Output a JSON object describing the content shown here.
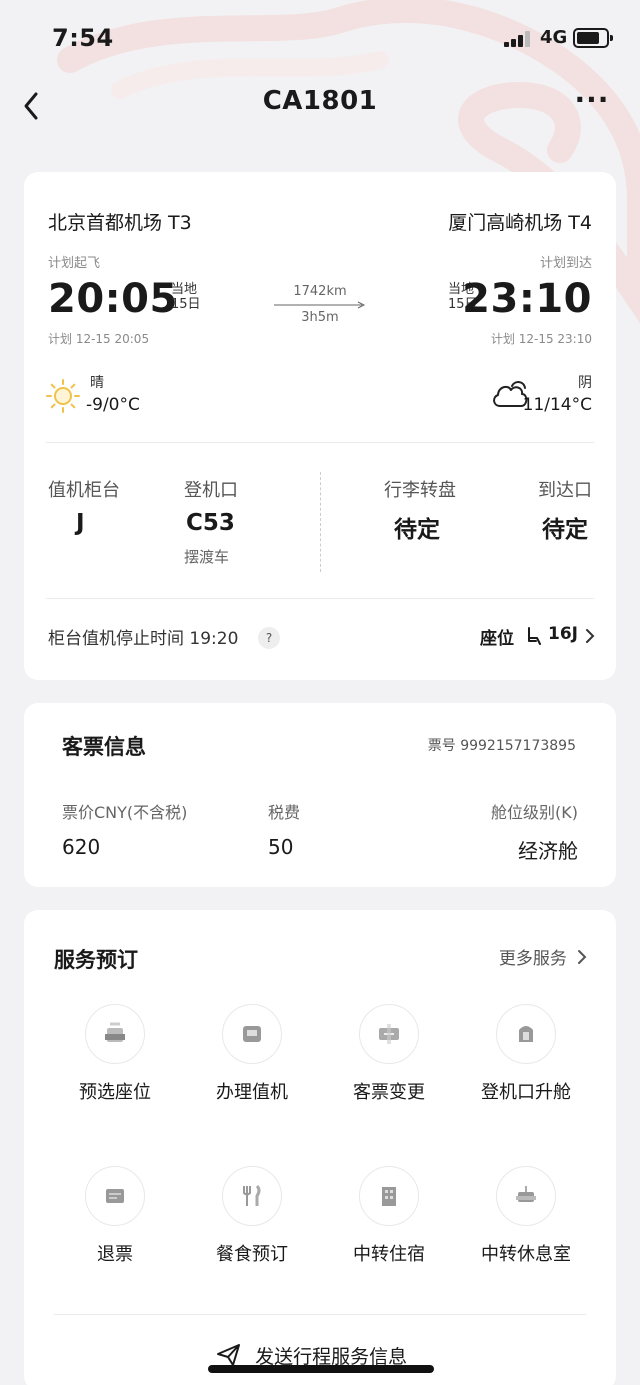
{
  "status_bar": {
    "time": "7:54",
    "network": "4G"
  },
  "nav": {
    "title": "CA1801",
    "more": "···"
  },
  "flight": {
    "departure": {
      "airport": "北京首都机场 T3",
      "label": "计划起飞",
      "time": "20:05",
      "local_label": "当地",
      "day": "15日",
      "plan": "计划 12-15 20:05",
      "weather": "晴",
      "temp": "-9/0°C"
    },
    "arrival": {
      "airport": "厦门高崎机场 T4",
      "label": "计划到达",
      "time": "23:10",
      "local_label": "当地",
      "day": "15日",
      "plan": "计划 12-15 23:10",
      "weather": "阴",
      "temp": "11/14°C"
    },
    "distance": "1742km",
    "duration": "3h5m"
  },
  "airport_info": {
    "checkin_label": "值机柜台",
    "checkin_value": "J",
    "gate_label": "登机口",
    "gate_value": "C53",
    "gate_note": "摆渡车",
    "baggage_label": "行李转盘",
    "baggage_value": "待定",
    "exit_label": "到达口",
    "exit_value": "待定"
  },
  "checkin_deadline": "柜台值机停止时间 19:20",
  "seat": {
    "label": "座位",
    "value": "16J"
  },
  "ticket": {
    "title": "客票信息",
    "number": "票号 9992157173895",
    "price_label": "票价CNY(不含税)",
    "price_value": "620",
    "tax_label": "税费",
    "tax_value": "50",
    "class_label": "舱位级别(K)",
    "class_value": "经济舱"
  },
  "services": {
    "title": "服务预订",
    "more": "更多服务",
    "items": [
      {
        "label": "预选座位",
        "icon": "seat-select-icon"
      },
      {
        "label": "办理值机",
        "icon": "checkin-icon"
      },
      {
        "label": "客票变更",
        "icon": "ticket-change-icon"
      },
      {
        "label": "登机口升舱",
        "icon": "upgrade-icon"
      },
      {
        "label": "退票",
        "icon": "refund-icon"
      },
      {
        "label": "餐食预订",
        "icon": "meal-icon"
      },
      {
        "label": "中转住宿",
        "icon": "hotel-icon"
      },
      {
        "label": "中转休息室",
        "icon": "lounge-icon"
      }
    ],
    "send": "发送行程服务信息"
  }
}
